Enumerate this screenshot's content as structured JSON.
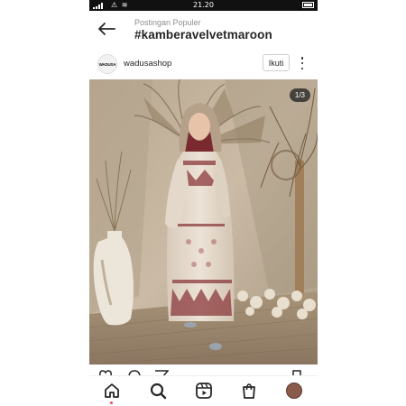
{
  "status_bar": {
    "time": "21.20"
  },
  "header": {
    "subtitle": "Postingan Populer",
    "title": "#kamberavelvetmaroon"
  },
  "post": {
    "avatar_text": "WADUSA",
    "username": "wadusashop",
    "follow_label": "Ikuti",
    "photo_counter": "1/3"
  },
  "icons": {
    "back": "arrow-left-icon",
    "more": "more-vertical-icon",
    "like": "heart-icon",
    "comment": "comment-icon",
    "share": "send-icon",
    "save": "bookmark-icon",
    "nav": [
      "home-icon",
      "search-icon",
      "reels-icon",
      "shop-icon",
      "profile-avatar"
    ]
  },
  "colors": {
    "accent_red": "#ed4956",
    "dress_maroon": "#7a2a2f",
    "text": "#262626"
  }
}
